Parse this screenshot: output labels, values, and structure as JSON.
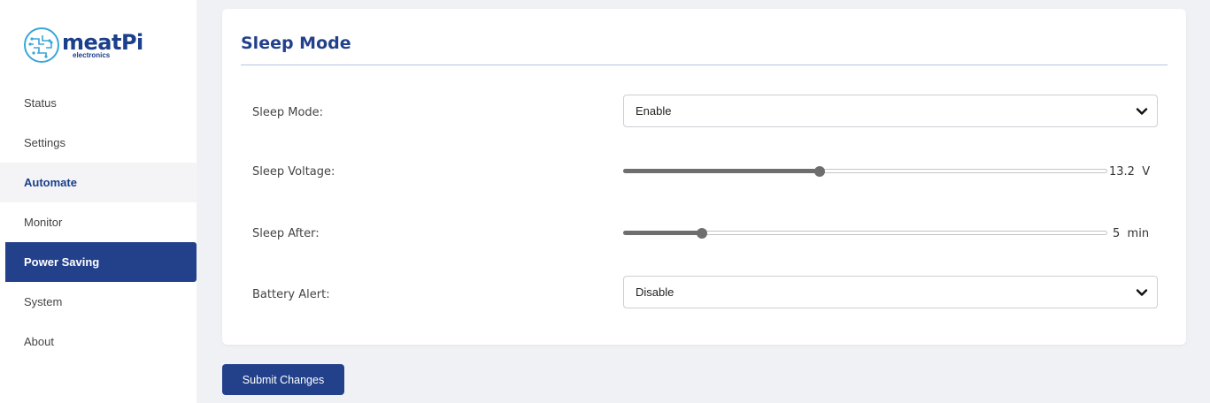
{
  "brand": {
    "name": "meatPi",
    "sub": "electronics"
  },
  "nav": {
    "items": [
      {
        "label": "Status"
      },
      {
        "label": "Settings"
      },
      {
        "label": "Automate"
      },
      {
        "label": "Monitor"
      },
      {
        "label": "Power Saving"
      },
      {
        "label": "System"
      },
      {
        "label": "About"
      }
    ],
    "active": "Power Saving"
  },
  "card": {
    "title": "Sleep Mode",
    "sleep_mode": {
      "label": "Sleep Mode:",
      "value": "Enable"
    },
    "sleep_voltage": {
      "label": "Sleep Voltage:",
      "value": "13.2",
      "unit": "V",
      "fraction": 0.405
    },
    "sleep_after": {
      "label": "Sleep After:",
      "value": "5",
      "unit": "min",
      "fraction": 0.162
    },
    "battery_alert": {
      "label": "Battery Alert:",
      "value": "Disable"
    }
  },
  "actions": {
    "submit_label": "Submit Changes"
  },
  "colors": {
    "accent": "#23418b",
    "background": "#f0f1f5",
    "slider_fill": "#6e6e6e"
  }
}
